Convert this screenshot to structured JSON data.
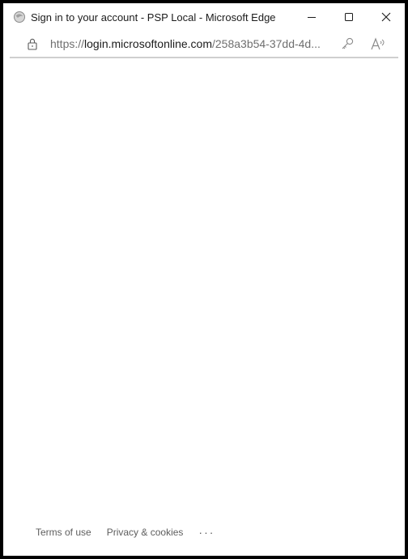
{
  "window": {
    "title": "Sign in to your account - PSP Local - Microsoft Edge",
    "app_icon": "edge-icon",
    "controls": [
      "minimize-icon",
      "maximize-icon",
      "close-icon"
    ]
  },
  "address_bar": {
    "url_scheme": "https://",
    "url_host": "login.microsoftonline.com",
    "url_path": "/258a3b54-37dd-4d...",
    "icons": [
      "lock-icon",
      "key-icon",
      "read-aloud-icon"
    ]
  },
  "footer": {
    "terms": "Terms of use",
    "privacy": "Privacy & cookies",
    "more": "···"
  },
  "colors": {
    "border": "#000000",
    "text": "#1b1b1b",
    "muted": "#6f6f6f",
    "footer_text": "#5e5e5e"
  }
}
